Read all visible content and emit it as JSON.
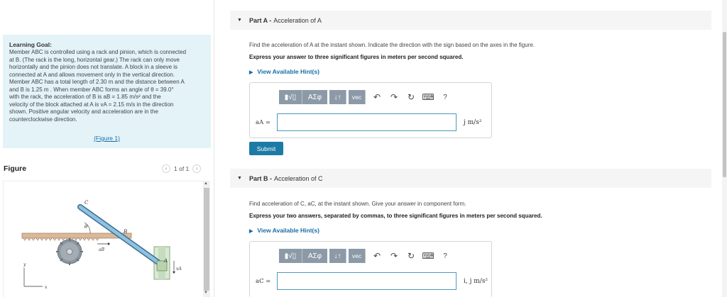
{
  "learning_goal": {
    "title": "Learning Goal:",
    "lines": [
      "Member ABC is controlled using a rack and pinion, which is connected",
      "at B. (The rack is the long, horizontal gear.) The rack can only move",
      "horizontally and the pinion does not translate. A block in a sleeve is",
      "connected at A and allows movement only in the vertical direction.",
      "Member ABC has a total length of 2.30 m and the distance between A",
      "and B is 1.25 m . When member ABC forms an angle of θ = 39.0°",
      "with the rack, the acceleration of B is aB = 1.85 m/s² and the",
      "velocity of the block attached at A is vA = 2.15 m/s in the direction",
      "shown. Positive angular velocity and acceleration are in the",
      "counterclockwise direction."
    ],
    "figure_link": "(Figure 1)"
  },
  "figure_panel": {
    "title": "Figure",
    "pager": "1 of 1",
    "labels": {
      "C": "C",
      "B": "B",
      "A": "A",
      "theta": "θ",
      "aB": "aB",
      "vA": "vA",
      "x": "x",
      "y": "y"
    }
  },
  "partA": {
    "header_bold": "Part A -",
    "header_rest": "Acceleration of A",
    "question": "Find the acceleration of A at the instant shown. Indicate the direction with the sign based on the axes in the figure.",
    "instruction": "Express your answer to three significant figures in meters per second squared.",
    "hints": "View Available Hint(s)",
    "answer_label": "aA =",
    "unit": "j m/s²",
    "submit": "Submit"
  },
  "partB": {
    "header_bold": "Part B -",
    "header_rest": "Acceleration of C",
    "question": "Find acceleration of C, aC, at the instant shown. Give your answer in component form.",
    "instruction": "Express your two answers, separated by commas, to three significant figures in meters per second squared.",
    "hints": "View Available Hint(s)",
    "answer_label": "aC =",
    "unit": "i, j m/s²"
  },
  "toolbar": {
    "templates": "▮√▯",
    "greek": "ΑΣφ",
    "sort": "↓↑",
    "vec": "vec",
    "undo": "↶",
    "redo": "↷",
    "reset": "↻",
    "keyboard": "⌨",
    "help": "?"
  },
  "colors": {
    "accent": "#1b7ba5",
    "goal_bg": "#e3f3f8",
    "toolbar_btn": "#8c9aa7"
  }
}
